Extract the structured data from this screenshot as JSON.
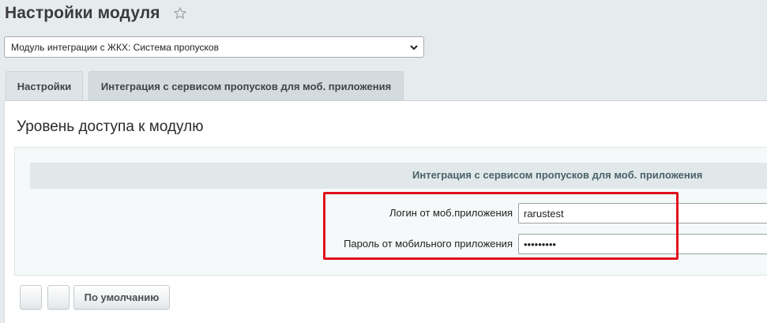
{
  "header": {
    "title": "Настройки модуля",
    "favorite_icon": "star-icon"
  },
  "module_select": {
    "selected": "Модуль интеграции с ЖКХ: Система пропусков"
  },
  "tabs": [
    {
      "label": "Настройки",
      "active": false
    },
    {
      "label": "Интеграция с сервисом пропусков для моб. приложения",
      "active": true
    }
  ],
  "section": {
    "title": "Уровень доступа к модулю",
    "group_header": "Интеграция с сервисом пропусков для моб. приложения"
  },
  "fields": {
    "login": {
      "label": "Логин от моб.приложения",
      "value": "rarustest"
    },
    "password": {
      "label": "Пароль от мобильного приложения",
      "value": "•••••••••"
    }
  },
  "buttons": {
    "button_a": "",
    "button_b": "",
    "default_label": "По умолчанию"
  },
  "colors": {
    "highlight": "#e0121d",
    "background": "#e6ebed"
  }
}
